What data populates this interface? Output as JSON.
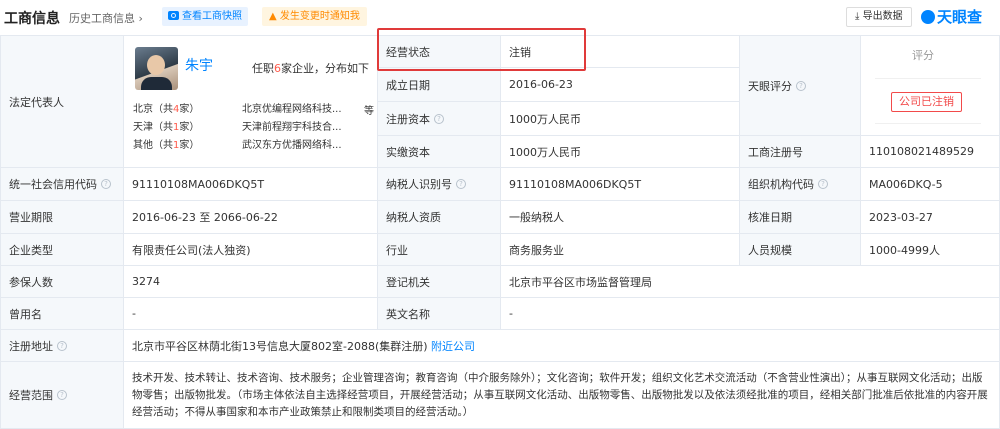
{
  "header": {
    "title": "工商信息",
    "history": "历史工商信息 ›",
    "snapshot_btn": "查看工商快照",
    "notify_btn": "发生变更时通知我",
    "export_btn": "导出数据",
    "logo_text": "天眼查"
  },
  "legal": {
    "label": "法定代表人",
    "name": "朱宇",
    "role_prefix": "任职",
    "role_count": "6",
    "role_suffix": "家企业，分布如下",
    "regions": [
      {
        "region": "北京（共",
        "count": "4",
        "close": "家）",
        "company": "北京优编程网络科技..."
      },
      {
        "region": "天津（共",
        "count": "1",
        "close": "家）",
        "company": "天津前程翔宇科技合..."
      },
      {
        "region": "其他（共",
        "count": "1",
        "close": "家）",
        "company": "武汉东方优播网络科..."
      }
    ],
    "more": "等"
  },
  "fields": {
    "status_label": "经营状态",
    "status_value": "注销",
    "found_label": "成立日期",
    "found_value": "2016-06-23",
    "capital_label": "注册资本",
    "capital_value": "1000万人民币",
    "paid_label": "实缴资本",
    "paid_value": "1000万人民币",
    "score_label": "天眼评分",
    "score_title": "评分",
    "score_stamp": "公司已注销",
    "regno_label": "工商注册号",
    "regno_value": "110108021489529",
    "credit_label": "统一社会信用代码",
    "credit_value": "91110108MA006DKQ5T",
    "taxid_label": "纳税人识别号",
    "taxid_value": "91110108MA006DKQ5T",
    "org_label": "组织机构代码",
    "org_value": "MA006DKQ-5",
    "term_label": "营业期限",
    "term_value": "2016-06-23 至 2066-06-22",
    "taxq_label": "纳税人资质",
    "taxq_value": "一般纳税人",
    "approve_label": "核准日期",
    "approve_value": "2023-03-27",
    "type_label": "企业类型",
    "type_value": "有限责任公司(法人独资)",
    "industry_label": "行业",
    "industry_value": "商务服务业",
    "staff_label": "人员规模",
    "staff_value": "1000-4999人",
    "insured_label": "参保人数",
    "insured_value": "3274",
    "authority_label": "登记机关",
    "authority_value": "北京市平谷区市场监督管理局",
    "former_label": "曾用名",
    "former_value": "-",
    "en_label": "英文名称",
    "en_value": "-",
    "addr_label": "注册地址",
    "addr_value": "北京市平谷区林荫北街13号信息大厦802室-2088(集群注册)",
    "addr_link": "附近公司",
    "scope_label": "经营范围",
    "scope_value": "技术开发、技术转让、技术咨询、技术服务；企业管理咨询；教育咨询（中介服务除外）；文化咨询；软件开发；组织文化艺术交流活动（不含营业性演出）；从事互联网文化活动；出版物零售；出版物批发。（市场主体依法自主选择经营项目，开展经营活动；从事互联网文化活动、出版物零售、出版物批发以及依法须经批准的项目，经相关部门批准后依批准的内容开展经营活动；不得从事国家和本市产业政策禁止和限制类项目的经营活动。）"
  },
  "colors": {
    "accent": "#0084ff",
    "danger": "#e03a3a",
    "label_bg": "#f5f8fb"
  }
}
